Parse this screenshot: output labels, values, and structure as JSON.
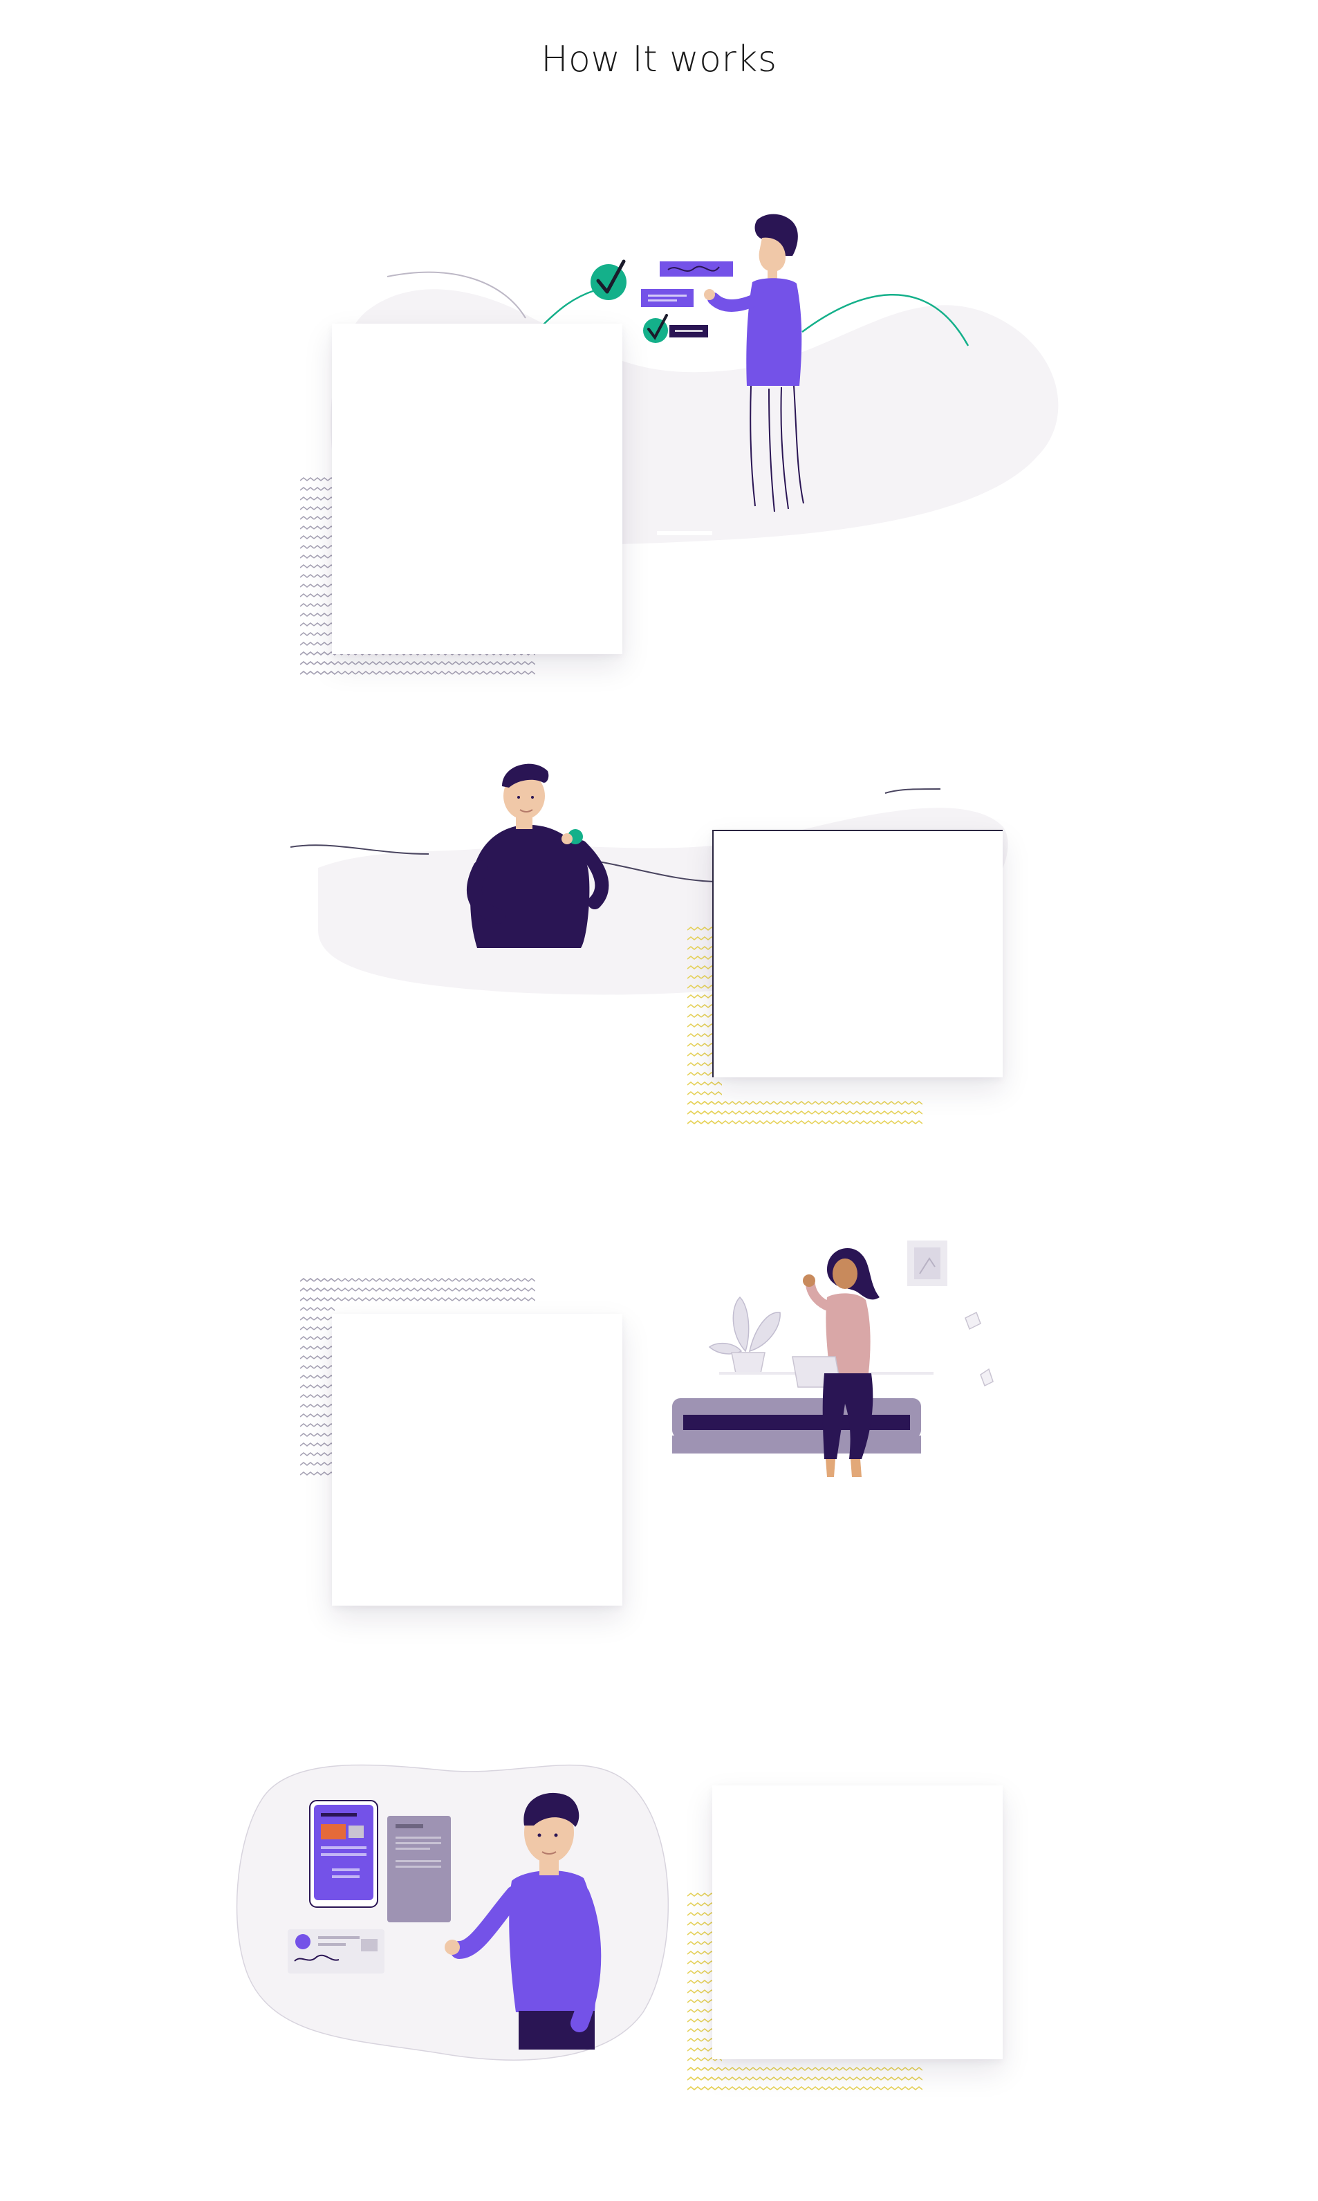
{
  "page": {
    "title": "How It works"
  },
  "colors": {
    "brand_purple": "#7452e8",
    "dark_navy": "#2a1554",
    "teal_check": "#14b08a",
    "blob_gray": "#f5f3f6",
    "zigzag_gray": "#a7a3b5",
    "zigzag_yellow": "#e6d25a",
    "sofa_gray": "#9e93b3",
    "skin_tone": "#f0c8a8",
    "blouse_pink": "#d9a7a7"
  },
  "steps": [
    {
      "id": "step-1",
      "illustration": "man-reviewing-checklist",
      "zigzag_color": "gray",
      "card_side": "left",
      "card_text": ""
    },
    {
      "id": "step-2",
      "illustration": "man-holding-token",
      "zigzag_color": "yellow",
      "card_side": "right",
      "card_text": ""
    },
    {
      "id": "step-3",
      "illustration": "woman-with-laptop-on-sofa",
      "zigzag_color": "gray",
      "card_side": "left",
      "card_text": ""
    },
    {
      "id": "step-4",
      "illustration": "man-presenting-documents",
      "zigzag_color": "yellow",
      "card_side": "right",
      "card_text": ""
    }
  ]
}
